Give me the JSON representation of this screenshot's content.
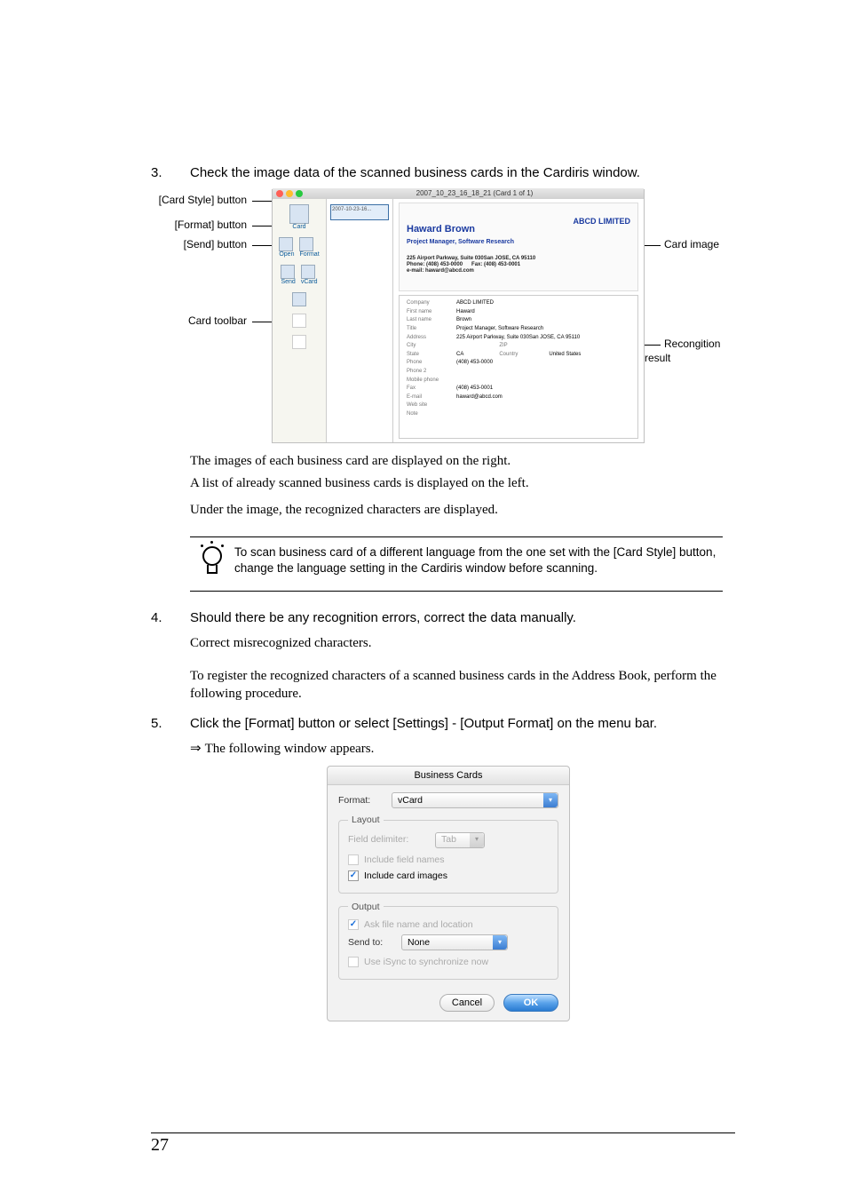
{
  "steps": {
    "s3": {
      "num": "3.",
      "heading": "Check the image data of the scanned business cards in the Cardiris window.",
      "callouts_left": {
        "card_style": "[Card Style] button",
        "format": "[Format] button",
        "send": "[Send] button",
        "toolbar": "Card toolbar"
      },
      "callouts_right": {
        "card_image": "Card image",
        "recognition": "Recongition result"
      },
      "window": {
        "title": "2007_10_23_16_18_21 (Card 1 of 1)",
        "toolbar_labels": {
          "card": "Card",
          "open": "Open",
          "format": "Format",
          "send": "Send",
          "vcard": "vCard"
        },
        "list_item": "2007-10-23-16...",
        "business_card": {
          "company": "ABCD LIMITED",
          "name": "Haward Brown",
          "title": "Project Manager, Software Research",
          "addr1": "225 Airport Parkway, Suite 030San JOSE, CA 95110",
          "phone": "Phone: (408) 453-0000",
          "fax": "Fax: (408) 453-0001",
          "email": "e-mail: haward@abcd.com"
        },
        "recog": {
          "company_label": "Company",
          "company": "ABCD LIMITED",
          "first_label": "First name",
          "first": "Haward",
          "last_label": "Last name",
          "last": "Brown",
          "title_label": "Title",
          "title": "Project Manager, Software Research",
          "address_label": "Address",
          "address": "225 Airport Parkway, Suite 030San JOSE, CA 95110",
          "city_label": "City",
          "city": "",
          "zip_label": "ZIP",
          "zip": "",
          "state_label": "State",
          "state": "CA",
          "country_label": "Country",
          "country": "United States",
          "phone_label": "Phone",
          "phone": "(408) 453-0000",
          "phone2_label": "Phone 2",
          "phone2": "",
          "mobile_label": "Mobile phone",
          "mobile": "",
          "fax_label": "Fax",
          "fax": "(408) 453-0001",
          "email_label": "E-mail",
          "email": "haward@abcd.com",
          "web_label": "Web site",
          "web": "",
          "note_label": "Note",
          "note": ""
        }
      },
      "body1": "The images of each business card are displayed on the right.",
      "body2": "A list of already scanned business cards is displayed on the left.",
      "body3": "Under the image, the recognized characters are displayed.",
      "tip": "To scan business card of a different language from the one set with the [Card Style] button, change the language setting in the Cardiris window before scanning."
    },
    "s4": {
      "num": "4.",
      "heading": "Should there be any recognition errors, correct the data manually.",
      "body1": "Correct misrecognized characters.",
      "body2": "To register the recognized characters of a scanned business cards in the Address Book, perform the following procedure."
    },
    "s5": {
      "num": "5.",
      "heading": "Click the [Format] button or select [Settings] - [Output Format] on the menu bar.",
      "arrow": "⇒",
      "arrow_text": "The following window appears."
    }
  },
  "dialog": {
    "title": "Business Cards",
    "format_label": "Format:",
    "format_value": "vCard",
    "layout_legend": "Layout",
    "field_delim_label": "Field delimiter:",
    "field_delim_value": "Tab",
    "include_fields": "Include field names",
    "include_images": "Include card images",
    "output_legend": "Output",
    "ask_file": "Ask file name and location",
    "sendto_label": "Send to:",
    "sendto_value": "None",
    "use_isync": "Use iSync to synchronize now",
    "cancel": "Cancel",
    "ok": "OK"
  },
  "pagenum": "27"
}
